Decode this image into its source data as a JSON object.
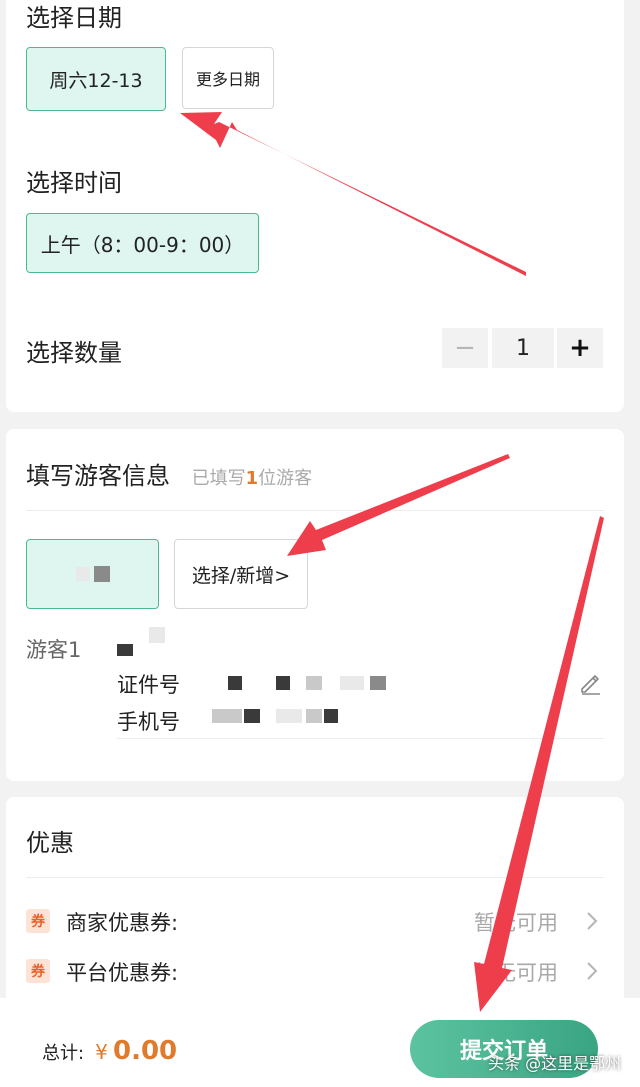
{
  "date_section": {
    "title": "选择日期",
    "selected_date": "周六12-13",
    "more_dates": "更多日期"
  },
  "time_section": {
    "title": "选择时间",
    "selected_time": "上午（8：00-9：00）"
  },
  "quantity_section": {
    "title": "选择数量",
    "minus": "−",
    "value": "1",
    "plus": "+"
  },
  "visitor_section": {
    "title": "填写游客信息",
    "hint_prefix": "已填写",
    "hint_count": "1",
    "hint_suffix": "位游客",
    "add_button": "选择/新增>",
    "visitor_label": "游客1",
    "id_label": "证件号",
    "phone_label": "手机号",
    "edit_icon": "pencil-icon"
  },
  "discount_section": {
    "title": "优惠",
    "coupons": [
      {
        "icon_text": "券",
        "label": "商家优惠券:",
        "value": "暂无可用"
      },
      {
        "icon_text": "券",
        "label": "平台优惠券:",
        "value": "暂无可用"
      }
    ]
  },
  "footer": {
    "total_label": "总计:",
    "currency": "¥",
    "total_value": "0.00",
    "submit": "提交订单"
  },
  "watermark": "头条 @这里是鄂州",
  "colors": {
    "accent": "#3aa583",
    "selected_bg": "#dff5ef",
    "price": "#e07a2c",
    "annotation_arrow": "#ee3e4c"
  }
}
